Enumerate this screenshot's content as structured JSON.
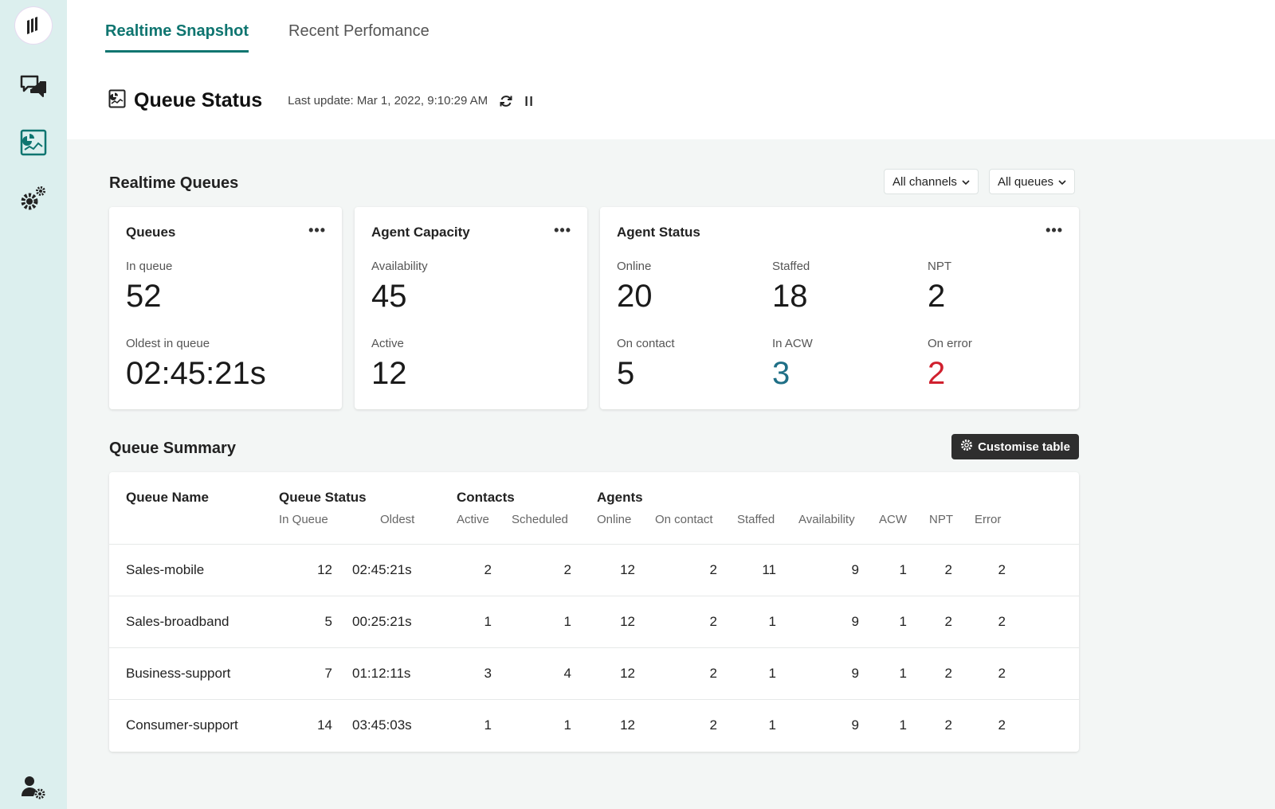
{
  "tabs": [
    {
      "label": "Realtime Snapshot",
      "active": true
    },
    {
      "label": "Recent Perfomance",
      "active": false
    }
  ],
  "page": {
    "title": "Queue Status",
    "last_update": "Last update: Mar 1, 2022, 9:10:29 AM"
  },
  "realtime": {
    "title": "Realtime Queues",
    "filters": {
      "channels": "All channels",
      "queues": "All queues"
    },
    "queues_card": {
      "title": "Queues",
      "in_queue_label": "In queue",
      "in_queue_value": "52",
      "oldest_label": "Oldest in queue",
      "oldest_value": "02:45:21s"
    },
    "capacity_card": {
      "title": "Agent Capacity",
      "availability_label": "Availability",
      "availability_value": "45",
      "active_label": "Active",
      "active_value": "12"
    },
    "status_card": {
      "title": "Agent Status",
      "online_label": "Online",
      "online_value": "20",
      "staffed_label": "Staffed",
      "staffed_value": "18",
      "npt_label": "NPT",
      "npt_value": "2",
      "on_contact_label": "On contact",
      "on_contact_value": "5",
      "in_acw_label": "In ACW",
      "in_acw_value": "3",
      "on_error_label": "On error",
      "on_error_value": "2"
    },
    "more_label": "•••"
  },
  "summary": {
    "title": "Queue Summary",
    "customise_label": "Customise table",
    "groups": {
      "name": "Queue Name",
      "status": "Queue Status",
      "contacts": "Contacts",
      "agents": "Agents"
    },
    "subheaders": {
      "in_queue": "In Queue",
      "oldest": "Oldest",
      "active": "Active",
      "scheduled": "Scheduled",
      "online": "Online",
      "on_contact": "On contact",
      "staffed": "Staffed",
      "availability": "Availability",
      "acw": "ACW",
      "npt": "NPT",
      "error": "Error"
    },
    "rows": [
      {
        "name": "Sales-mobile",
        "in_queue": "12",
        "oldest": "02:45:21s",
        "active": "2",
        "scheduled": "2",
        "online": "12",
        "on_contact": "2",
        "staffed": "11",
        "availability": "9",
        "acw": "1",
        "npt": "2",
        "error": "2"
      },
      {
        "name": "Sales-broadband",
        "in_queue": "5",
        "oldest": "00:25:21s",
        "active": "1",
        "scheduled": "1",
        "online": "12",
        "on_contact": "2",
        "staffed": "1",
        "availability": "9",
        "acw": "1",
        "npt": "2",
        "error": "2"
      },
      {
        "name": "Business-support",
        "in_queue": "7",
        "oldest": "01:12:11s",
        "active": "3",
        "scheduled": "4",
        "online": "12",
        "on_contact": "2",
        "staffed": "1",
        "availability": "9",
        "acw": "1",
        "npt": "2",
        "error": "2"
      },
      {
        "name": "Consumer-support",
        "in_queue": "14",
        "oldest": "03:45:03s",
        "active": "1",
        "scheduled": "1",
        "online": "12",
        "on_contact": "2",
        "staffed": "1",
        "availability": "9",
        "acw": "1",
        "npt": "2",
        "error": "2"
      }
    ]
  },
  "colors": {
    "accent": "#0f7570",
    "acw_value": "#1f6f86",
    "error_value": "#d0202e",
    "sidebar_bg": "#dcefee"
  },
  "icons": {
    "sidebar": [
      "logo-icon",
      "chat-icon",
      "dashboard-icon",
      "settings-icon",
      "user-settings-icon"
    ]
  }
}
